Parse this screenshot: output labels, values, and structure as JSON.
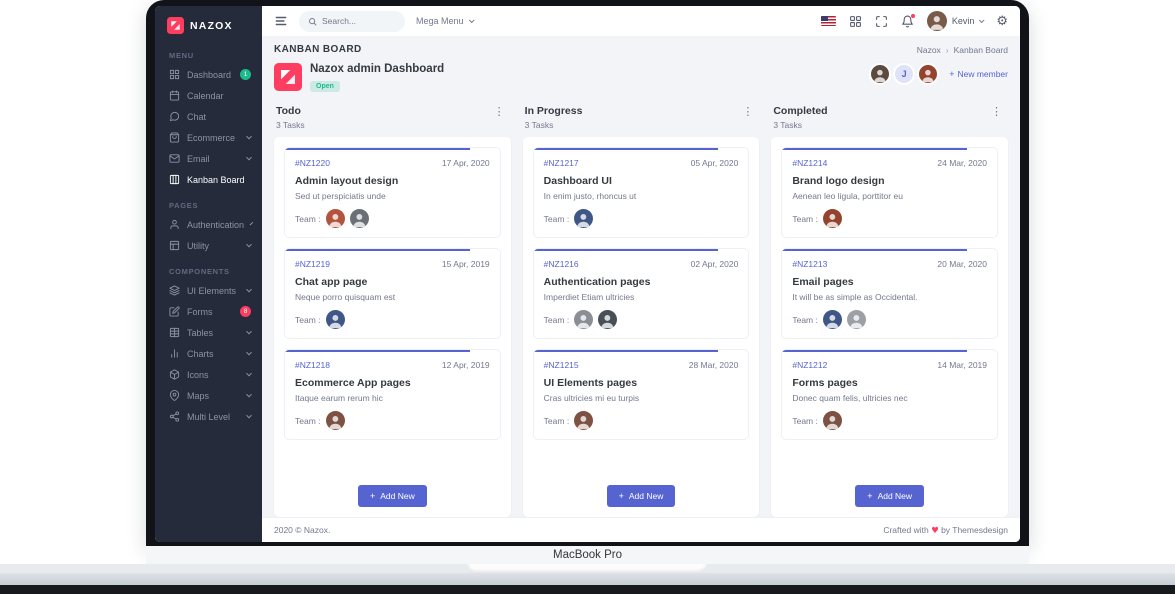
{
  "device": {
    "label": "MacBook Pro"
  },
  "navbar": {
    "search_placeholder": "Search...",
    "mega_menu_label": "Mega Menu",
    "user_name": "Kevin"
  },
  "sidebar": {
    "brand": "NAZOX",
    "sections": [
      {
        "label": "MENU",
        "items": [
          {
            "label": "Dashboard",
            "icon": "dashboard-icon",
            "badge": "1",
            "badge_color": "#1cbb8c"
          },
          {
            "label": "Calendar",
            "icon": "calendar-icon"
          },
          {
            "label": "Chat",
            "icon": "chat-icon"
          },
          {
            "label": "Ecommerce",
            "icon": "ecommerce-icon",
            "chevron": true
          },
          {
            "label": "Email",
            "icon": "email-icon",
            "chevron": true
          },
          {
            "label": "Kanban Board",
            "icon": "kanban-icon",
            "active": true
          }
        ]
      },
      {
        "label": "PAGES",
        "items": [
          {
            "label": "Authentication",
            "icon": "authentication-icon",
            "chevron": true
          },
          {
            "label": "Utility",
            "icon": "utility-icon",
            "chevron": true
          }
        ]
      },
      {
        "label": "COMPONENTS",
        "items": [
          {
            "label": "UI Elements",
            "icon": "ui-elements-icon",
            "chevron": true
          },
          {
            "label": "Forms",
            "icon": "forms-icon",
            "badge": "8",
            "badge_color": "#ff3d60"
          },
          {
            "label": "Tables",
            "icon": "tables-icon",
            "chevron": true
          },
          {
            "label": "Charts",
            "icon": "charts-icon",
            "chevron": true
          },
          {
            "label": "Icons",
            "icon": "icons-icon",
            "chevron": true
          },
          {
            "label": "Maps",
            "icon": "maps-icon",
            "chevron": true
          },
          {
            "label": "Multi Level",
            "icon": "multi-level-icon",
            "chevron": true
          }
        ]
      }
    ]
  },
  "page": {
    "title": "KANBAN BOARD",
    "breadcrumb": {
      "parent": "Nazox",
      "current": "Kanban Board"
    },
    "project": {
      "name": "Nazox admin Dashboard",
      "status": "Open"
    },
    "team": {
      "avatars": [
        {
          "type": "photo",
          "color": "#5d4a3f"
        },
        {
          "type": "initial",
          "initial": "J"
        },
        {
          "type": "photo",
          "color": "#94442e"
        }
      ],
      "add_label": "New member"
    }
  },
  "board": {
    "team_label": "Team :",
    "add_new_label": "Add New",
    "columns": [
      {
        "title": "Todo",
        "count": "3 Tasks",
        "cards": [
          {
            "id": "#NZ1220",
            "date": "17 Apr, 2020",
            "title": "Admin layout design",
            "desc": "Sed ut perspiciatis unde",
            "team": [
              "#b3543e",
              "#6b6f76"
            ]
          },
          {
            "id": "#NZ1219",
            "date": "15 Apr, 2019",
            "title": "Chat app page",
            "desc": "Neque porro quisquam est",
            "team": [
              "#3f5787"
            ]
          },
          {
            "id": "#NZ1218",
            "date": "12 Apr, 2019",
            "title": "Ecommerce App pages",
            "desc": "Itaque earum rerum hic",
            "team": [
              "#7d5242"
            ]
          }
        ]
      },
      {
        "title": "In Progress",
        "count": "3 Tasks",
        "cards": [
          {
            "id": "#NZ1217",
            "date": "05 Apr, 2020",
            "title": "Dashboard UI",
            "desc": "In enim justo, rhoncus ut",
            "team": [
              "#3f5787"
            ]
          },
          {
            "id": "#NZ1216",
            "date": "02 Apr, 2020",
            "title": "Authentication pages",
            "desc": "Imperdiet Etiam ultricies",
            "team": [
              "#8a8f96",
              "#494f57"
            ]
          },
          {
            "id": "#NZ1215",
            "date": "28 Mar, 2020",
            "title": "UI Elements pages",
            "desc": "Cras ultricies mi eu turpis",
            "team": [
              "#7d5242"
            ]
          }
        ]
      },
      {
        "title": "Completed",
        "count": "3 Tasks",
        "cards": [
          {
            "id": "#NZ1214",
            "date": "24 Mar, 2020",
            "title": "Brand logo design",
            "desc": "Aenean leo ligula, porttitor eu",
            "team": [
              "#94442e"
            ]
          },
          {
            "id": "#NZ1213",
            "date": "20 Mar, 2020",
            "title": "Email pages",
            "desc": "It will be as simple as Occidental.",
            "team": [
              "#3f5787",
              "#9aa0a6"
            ]
          },
          {
            "id": "#NZ1212",
            "date": "14 Mar, 2019",
            "title": "Forms pages",
            "desc": "Donec quam felis, ultricies nec",
            "team": [
              "#7d5242"
            ]
          }
        ]
      }
    ]
  },
  "footer": {
    "left": "2020 © Nazox.",
    "right_prefix": "Crafted with",
    "right_suffix": "by Themesdesign"
  },
  "colors": {
    "primary": "#5664d2",
    "success": "#1cbb8c",
    "danger": "#ff3d60",
    "sidebar": "#252b3b"
  }
}
